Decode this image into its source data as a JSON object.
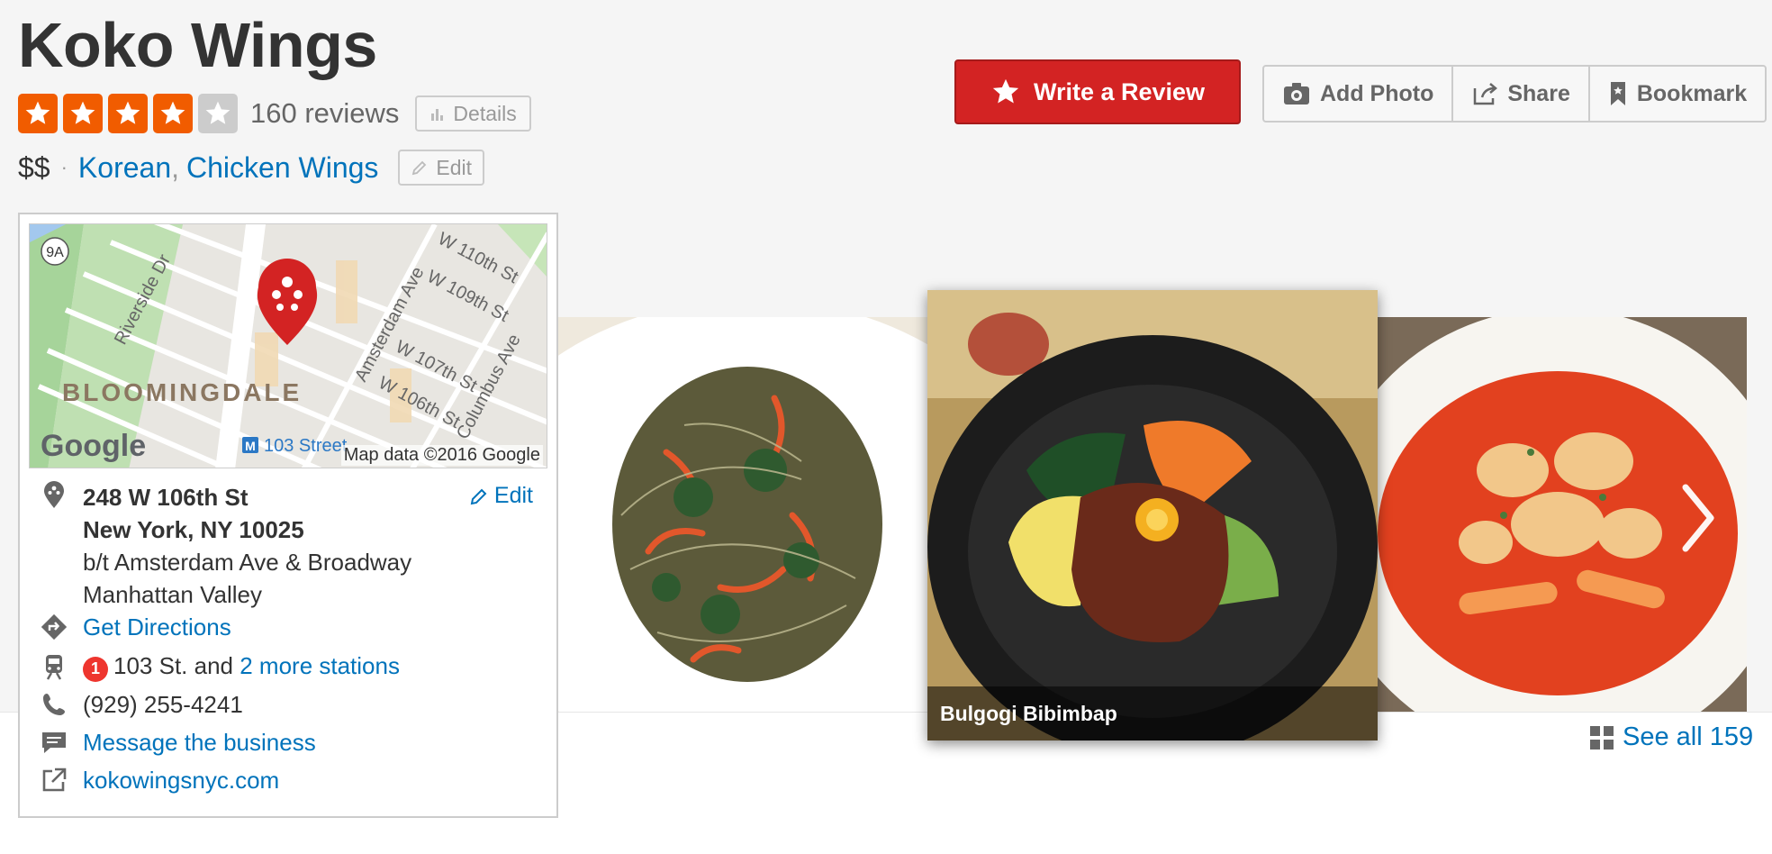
{
  "business": {
    "name": "Koko Wings",
    "rating": 4,
    "rating_max": 5,
    "review_count": "160 reviews",
    "details_label": "Details",
    "price": "$$",
    "separator": "·",
    "categories": [
      "Korean",
      "Chicken Wings"
    ],
    "category_comma": ",",
    "edit_label": "Edit"
  },
  "actions": {
    "write_review": "Write a Review",
    "add_photo": "Add Photo",
    "share": "Share",
    "bookmark": "Bookmark"
  },
  "map": {
    "neighborhood_label": "BLOOMINGDALE",
    "credit": "Map data ©2016 Google",
    "brand": "Google",
    "station_label": "103 Street",
    "route_shield": "9A",
    "streets": [
      "Riverside Dr",
      "Amsterdam Ave",
      "W 110th St",
      "W 109th St",
      "W 107th St",
      "W 106th St",
      "Columbus Ave"
    ]
  },
  "address": {
    "line1": "248 W 106th St",
    "line2": "New York, NY 10025",
    "cross": "b/t Amsterdam Ave & Broadway",
    "neighborhood": "Manhattan Valley",
    "edit_label": "Edit"
  },
  "directions": "Get Directions",
  "transit": {
    "line_badge": "1",
    "station": "103 St. and ",
    "more_link": "2 more stations"
  },
  "phone": "(929) 255-4241",
  "message": "Message the business",
  "website": "kokowingsnyc.com",
  "photos": {
    "featured_caption": "Bulgogi Bibimbap",
    "see_all": "See all 159"
  },
  "colors": {
    "star_on": "#f15c00",
    "star_off": "#cccccc",
    "brand_red": "#d32323",
    "link": "#0073bb"
  }
}
